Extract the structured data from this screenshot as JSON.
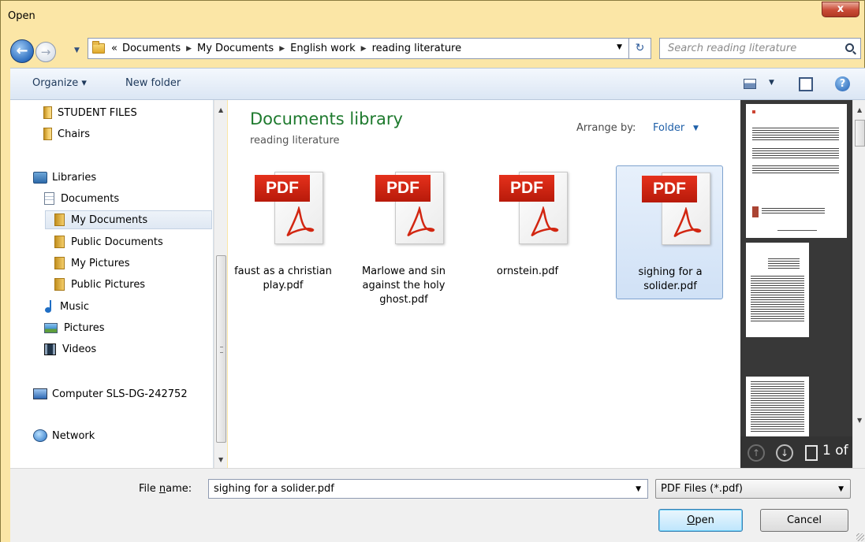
{
  "window": {
    "title": "Open",
    "close_label": "x"
  },
  "nav": {
    "back_glyph": "←",
    "forward_glyph": "→",
    "history_glyph": "▼"
  },
  "address": {
    "prefix": "«",
    "crumbs": [
      "Documents",
      "My Documents",
      "English work",
      "reading literature"
    ],
    "separator": "▶",
    "dropdown_glyph": "▼",
    "refresh_glyph": "↻"
  },
  "search": {
    "placeholder": "Search reading literature"
  },
  "toolbar": {
    "organize_label": "Organize ▾",
    "new_folder_label": "New folder",
    "views_dropdown_glyph": "▼",
    "help_glyph": "?"
  },
  "navpane": {
    "items": [
      {
        "label": "STUDENT FILES",
        "icon": "folder-icon"
      },
      {
        "label": "Chairs",
        "icon": "folder-icon"
      },
      {
        "label": "Libraries",
        "icon": "libraries-icon"
      },
      {
        "label": "Documents",
        "icon": "documents-icon"
      },
      {
        "label": "My Documents",
        "icon": "folder-icon",
        "selected": true
      },
      {
        "label": "Public Documents",
        "icon": "folder-icon"
      },
      {
        "label": "My Pictures",
        "icon": "folder-icon"
      },
      {
        "label": "Public Pictures",
        "icon": "folder-icon"
      },
      {
        "label": "Music",
        "icon": "music-icon"
      },
      {
        "label": "Pictures",
        "icon": "pictures-icon"
      },
      {
        "label": "Videos",
        "icon": "videos-icon"
      },
      {
        "label": "Computer SLS-DG-242752",
        "icon": "computer-icon"
      },
      {
        "label": "Network",
        "icon": "network-icon"
      }
    ]
  },
  "content": {
    "library_title": "Documents library",
    "library_subtitle": "reading literature",
    "arrange_label": "Arrange by:",
    "arrange_value": "Folder",
    "arrange_glyph": "▼",
    "pdf_badge": "PDF",
    "files": [
      {
        "name": "faust as a christian play.pdf",
        "selected": false
      },
      {
        "name": "Marlowe and sin against the holy ghost.pdf",
        "selected": false
      },
      {
        "name": "ornstein.pdf",
        "selected": false
      },
      {
        "name": "sighing for a solider.pdf",
        "selected": true
      }
    ]
  },
  "preview": {
    "page_counter": "1 of",
    "up_glyph": "↑",
    "down_glyph": "↓"
  },
  "bottom": {
    "file_name_label_pre": "File ",
    "file_name_label_u": "n",
    "file_name_label_post": "ame:",
    "file_name_value": "sighing for a solider.pdf",
    "file_type_value": "PDF Files (*.pdf)",
    "dropdown_glyph": "▼",
    "open_label_u": "O",
    "open_label_rest": "pen",
    "cancel_label": "Cancel"
  },
  "scroll": {
    "up_glyph": "▲",
    "down_glyph": "▼"
  },
  "colors": {
    "frame": "#fbe6a6",
    "library_title": "#1e7a2e",
    "link": "#1e5fa8",
    "pdf_red": "#d22611"
  }
}
